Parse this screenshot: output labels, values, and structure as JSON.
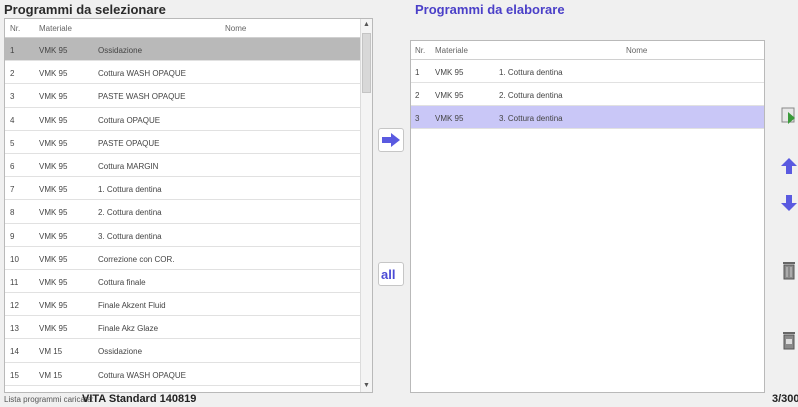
{
  "left": {
    "title": "Programmi da selezionare",
    "headers": {
      "no": "Nr.",
      "material": "Materiale",
      "name": "Nome"
    },
    "rows": [
      {
        "no": "1",
        "material": "VMK 95",
        "name": "Ossidazione"
      },
      {
        "no": "2",
        "material": "VMK 95",
        "name": "Cottura WASH OPAQUE"
      },
      {
        "no": "3",
        "material": "VMK 95",
        "name": "PASTE WASH OPAQUE"
      },
      {
        "no": "4",
        "material": "VMK 95",
        "name": "Cottura OPAQUE"
      },
      {
        "no": "5",
        "material": "VMK 95",
        "name": "PASTE OPAQUE"
      },
      {
        "no": "6",
        "material": "VMK 95",
        "name": "Cottura MARGIN"
      },
      {
        "no": "7",
        "material": "VMK 95",
        "name": "1. Cottura dentina"
      },
      {
        "no": "8",
        "material": "VMK 95",
        "name": "2. Cottura dentina"
      },
      {
        "no": "9",
        "material": "VMK 95",
        "name": "3. Cottura dentina"
      },
      {
        "no": "10",
        "material": "VMK 95",
        "name": "Correzione con COR."
      },
      {
        "no": "11",
        "material": "VMK 95",
        "name": "Cottura finale"
      },
      {
        "no": "12",
        "material": "VMK 95",
        "name": "Finale Akzent Fluid"
      },
      {
        "no": "13",
        "material": "VMK 95",
        "name": "Finale Akz Glaze"
      },
      {
        "no": "14",
        "material": "VM 15",
        "name": "Ossidazione"
      },
      {
        "no": "15",
        "material": "VM 15",
        "name": "Cottura WASH OPAQUE"
      }
    ]
  },
  "right": {
    "title": "Programmi da elaborare",
    "headers": {
      "no": "Nr.",
      "material": "Materiale",
      "name": "Nome"
    },
    "rows": [
      {
        "no": "1",
        "material": "VMK 95",
        "name": "1. Cottura dentina"
      },
      {
        "no": "2",
        "material": "VMK 95",
        "name": "2. Cottura dentina"
      },
      {
        "no": "3",
        "material": "VMK 95",
        "name": "3. Cottura dentina"
      }
    ]
  },
  "buttons": {
    "add_all_label": "all"
  },
  "footer": {
    "label": "Lista programmi caricata:",
    "list_name": "VITA  Standard  140819",
    "count": "3/300"
  },
  "colors": {
    "accent": "#4a3fc8",
    "selected_left": "#b9b9b9",
    "selected_right": "#c9c7f7",
    "arrow_blue": "#5a5ae0"
  },
  "icons": [
    "arrow-right-icon",
    "add-all-icon",
    "move-first-icon",
    "move-up-icon",
    "move-down-icon",
    "trash-icon",
    "trash-all-icon"
  ]
}
